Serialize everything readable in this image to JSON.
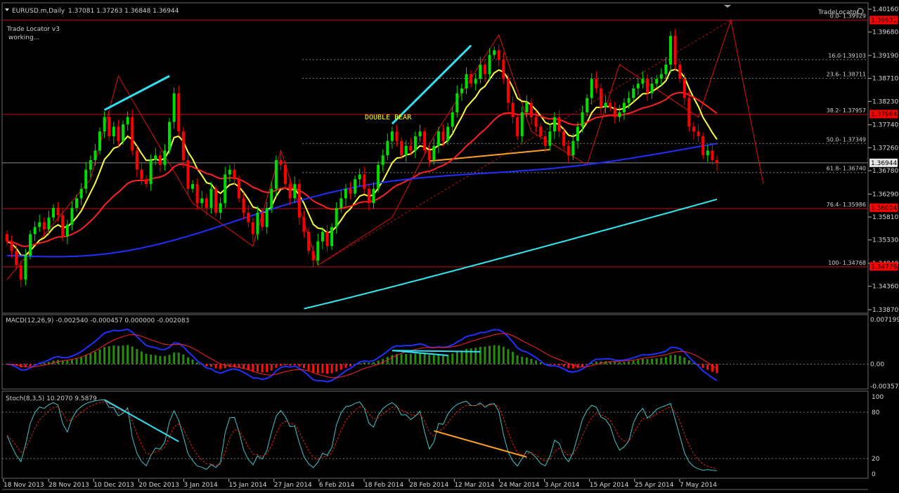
{
  "header": {
    "symbol": "EURUSD.m,Daily",
    "ohlc": "1.37081 1.37263 1.36848 1.36944",
    "indicator_name": "Trade Locator v3",
    "indicator_status": "working...",
    "corner_label": "TradeLocator"
  },
  "annotation": "DOUBLE BEAR",
  "colors": {
    "background": "#000000",
    "bull": "#00dd00",
    "bear": "#ff0000",
    "ema_fast": "#ffff40",
    "ema_mid": "#ff2020",
    "ema_slow": "#1f2fff",
    "ema_long": "#30e8f0",
    "fib_level": "#c01010",
    "price_marker": "#ff0000"
  },
  "chart_data": [
    {
      "type": "candlestick",
      "title": "EURUSD.m,Daily",
      "ylim": [
        1.3387,
        1.4016
      ],
      "y_ticks": [
        "1.40160",
        "1.39680",
        "1.39190",
        "1.38710",
        "1.38230",
        "1.37740",
        "1.37260",
        "1.36780",
        "1.36290",
        "1.35810",
        "1.35330",
        "1.34840",
        "1.34360",
        "1.33870"
      ],
      "current_price": "1.36944",
      "price_markers": [
        "1.39931",
        "1.37964",
        "1.36004",
        "1.34776"
      ],
      "x_tick_labels": [
        "18 Nov 2013",
        "28 Nov 2013",
        "10 Dec 2013",
        "20 Dec 2013",
        "3 Jan 2014",
        "15 Jan 2014",
        "27 Jan 2014",
        "6 Feb 2014",
        "18 Feb 2014",
        "28 Feb 2014",
        "12 Mar 2014",
        "24 Mar 2014",
        "3 Apr 2014",
        "15 Apr 2014",
        "25 Apr 2014",
        "7 May 2014"
      ],
      "fib_levels": [
        {
          "label": "0.0- 1.39929",
          "price": 1.39929
        },
        {
          "label": "16.0-1.39103",
          "price": 1.39103
        },
        {
          "label": "23.6- 1.38711",
          "price": 1.38711
        },
        {
          "label": "38.2- 1.37957",
          "price": 1.37957
        },
        {
          "label": "50.0- 1.37349",
          "price": 1.37349
        },
        {
          "label": "61.8- 1.36740",
          "price": 1.3674
        },
        {
          "label": "76.4- 1.35986",
          "price": 1.35986
        },
        {
          "label": "100- 1.34768",
          "price": 1.34768
        }
      ],
      "closes": [
        1.353,
        1.351,
        1.348,
        1.345,
        1.35,
        1.3545,
        1.356,
        1.357,
        1.3555,
        1.358,
        1.36,
        1.3585,
        1.354,
        1.3565,
        1.36,
        1.362,
        1.364,
        1.368,
        1.37,
        1.372,
        1.376,
        1.379,
        1.375,
        1.377,
        1.374,
        1.3775,
        1.379,
        1.372,
        1.368,
        1.366,
        1.365,
        1.37,
        1.371,
        1.369,
        1.372,
        1.378,
        1.384,
        1.376,
        1.37,
        1.364,
        1.365,
        1.361,
        1.362,
        1.36,
        1.364,
        1.359,
        1.361,
        1.367,
        1.368,
        1.366,
        1.362,
        1.359,
        1.357,
        1.3545,
        1.359,
        1.356,
        1.36,
        1.364,
        1.37,
        1.369,
        1.365,
        1.362,
        1.365,
        1.358,
        1.355,
        1.351,
        1.349,
        1.353,
        1.355,
        1.352,
        1.356,
        1.36,
        1.362,
        1.364,
        1.363,
        1.366,
        1.367,
        1.364,
        1.361,
        1.364,
        1.369,
        1.371,
        1.374,
        1.376,
        1.374,
        1.371,
        1.373,
        1.372,
        1.375,
        1.376,
        1.372,
        1.37,
        1.373,
        1.376,
        1.374,
        1.377,
        1.38,
        1.384,
        1.385,
        1.388,
        1.386,
        1.387,
        1.39,
        1.388,
        1.392,
        1.393,
        1.391,
        1.387,
        1.382,
        1.379,
        1.375,
        1.38,
        1.382,
        1.379,
        1.377,
        1.375,
        1.373,
        1.376,
        1.379,
        1.376,
        1.373,
        1.371,
        1.374,
        1.377,
        1.38,
        1.383,
        1.387,
        1.385,
        1.381,
        1.382,
        1.381,
        1.379,
        1.38,
        1.382,
        1.383,
        1.385,
        1.386,
        1.387,
        1.384,
        1.386,
        1.387,
        1.388,
        1.39,
        1.396,
        1.39,
        1.387,
        1.383,
        1.377,
        1.376,
        1.375,
        1.371,
        1.372,
        1.37,
        1.3694
      ],
      "macd": {
        "label": "MACD(12,26,9) -0.002540 -0.000457 0.000000 -0.002083",
        "y_ticks": [
          "0.007199",
          "0.00",
          "-0.003575"
        ]
      },
      "stoch": {
        "label": "Stoch(8,3,5) 10.2070 9.5879",
        "y_ticks": [
          "100",
          "80",
          "20",
          "0"
        ]
      }
    }
  ]
}
